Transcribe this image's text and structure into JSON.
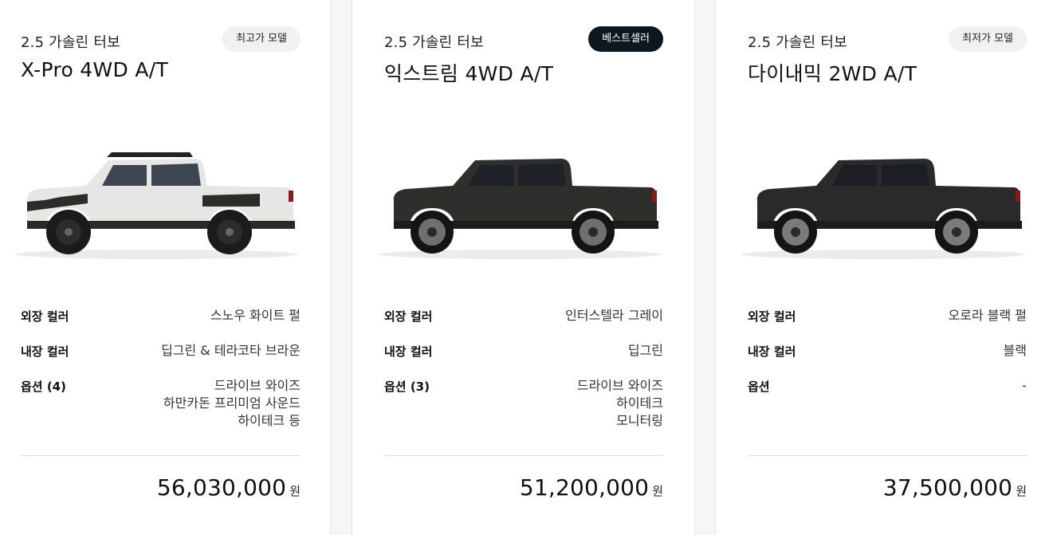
{
  "cards": [
    {
      "engine": "2.5 가솔린 터보",
      "trim": "X-Pro 4WD A/T",
      "badge": "최고가 모델",
      "car_color": "#e6e6e4",
      "labels": {
        "exterior": "외장 컬러",
        "interior": "내장 컬러",
        "options": "옵션 (4)"
      },
      "exterior": "스노우 화이트 펄",
      "interior": "딥그린 & 테라코타 브라운",
      "options": [
        "드라이브 와이즈",
        "하만카돈 프리미엄 사운드",
        "하이테크 등"
      ],
      "price": "56,030,000",
      "unit": "원"
    },
    {
      "engine": "2.5 가솔린 터보",
      "trim": "익스트림 4WD A/T",
      "badge": "베스트셀러",
      "car_color": "#2e2e2c",
      "labels": {
        "exterior": "외장 컬러",
        "interior": "내장 컬러",
        "options": "옵션 (3)"
      },
      "exterior": "인터스텔라 그레이",
      "interior": "딥그린",
      "options": [
        "드라이브 와이즈",
        "하이테크",
        "모니터링"
      ],
      "price": "51,200,000",
      "unit": "원"
    },
    {
      "engine": "2.5 가솔린 터보",
      "trim": "다이내믹 2WD A/T",
      "badge": "최저가 모델",
      "car_color": "#2a2a2a",
      "labels": {
        "exterior": "외장 컬러",
        "interior": "내장 컬러",
        "options": "옵션"
      },
      "exterior": "오로라 블랙 펄",
      "interior": "블랙",
      "options": [
        "-"
      ],
      "price": "37,500,000",
      "unit": "원"
    }
  ],
  "colors": {
    "badge_dark": "#0d1720",
    "badge_light": "#f1f1f1"
  }
}
